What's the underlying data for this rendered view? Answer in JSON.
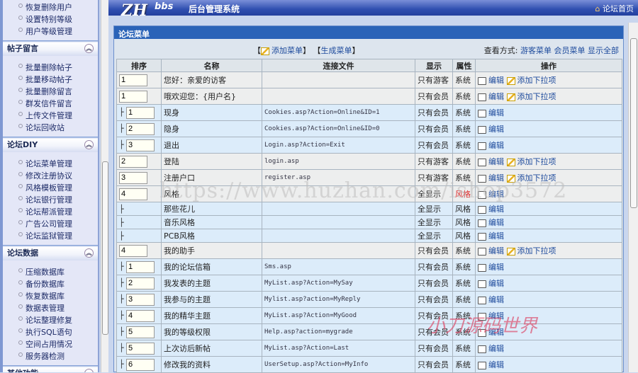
{
  "sidebar": {
    "top_items": [
      "恢复删除用户",
      "设置特别等级",
      "用户等级管理"
    ],
    "sections": [
      {
        "title": "帖子留言",
        "items": [
          "批量删除帖子",
          "批量移动帖子",
          "批量删除留言",
          "群发信件留言",
          "上传文件管理",
          "论坛回收站"
        ]
      },
      {
        "title": "论坛DIY",
        "items": [
          "论坛菜单管理",
          "修改注册协议",
          "风格模板管理",
          "论坛银行管理",
          "论坛帮派管理",
          "广告公司管理",
          "论坛监狱管理"
        ]
      },
      {
        "title": "论坛数据",
        "items": [
          "压缩数据库",
          "备份数据库",
          "恢复数据库",
          "数据表管理",
          "论坛整理修复",
          "执行SQL语句",
          "空间占用情况",
          "服务器检测"
        ]
      },
      {
        "title": "其他功能",
        "items": []
      }
    ]
  },
  "header": {
    "logo": "ZH",
    "logo_sub": "bbs",
    "system": "后台管理系统",
    "home": "论坛首页"
  },
  "panel": {
    "title": "论坛菜单",
    "add_menu": "添加菜单",
    "gen_menu": "生成菜单",
    "view_label": "查看方式:",
    "view_guest": "游客菜单",
    "view_member": "会员菜单",
    "view_all": "显示全部"
  },
  "table": {
    "headers": [
      "排序",
      "名称",
      "连接文件",
      "显示",
      "属性",
      "操作"
    ],
    "edit": "编辑",
    "add_sub": "添加下拉项",
    "rows": [
      {
        "level": "top",
        "order": "1",
        "name": "您好：亲爱的访客",
        "link": "",
        "show": "只有游客",
        "attr": "系统",
        "add": true
      },
      {
        "level": "top",
        "order": "1",
        "name": "哦欢迎您：{用户名}",
        "link": "",
        "show": "只有会员",
        "attr": "系统",
        "add": true
      },
      {
        "level": "child",
        "order": "1",
        "name": "现身",
        "link": "Cookies.asp?Action=Online&ID=1",
        "show": "只有会员",
        "attr": "系统"
      },
      {
        "level": "child",
        "order": "2",
        "name": "隐身",
        "link": "Cookies.asp?Action=Online&ID=0",
        "show": "只有会员",
        "attr": "系统"
      },
      {
        "level": "child",
        "order": "3",
        "name": "退出",
        "link": "Login.asp?Action=Exit",
        "show": "只有会员",
        "attr": "系统"
      },
      {
        "level": "top",
        "order": "2",
        "name": "登陆",
        "link": "login.asp",
        "show": "只有游客",
        "attr": "系统",
        "add": true
      },
      {
        "level": "top",
        "order": "3",
        "name": "注册户口",
        "link": "register.asp",
        "show": "只有游客",
        "attr": "系统",
        "add": true
      },
      {
        "level": "top",
        "order": "4",
        "name": "风格",
        "link": "",
        "show": "全显示",
        "attr": "风格",
        "attr_red": true
      },
      {
        "level": "child",
        "order": null,
        "name": "那些花儿",
        "link": "",
        "show": "全显示",
        "attr": "风格"
      },
      {
        "level": "child",
        "order": null,
        "name": "音乐风格",
        "link": "",
        "show": "全显示",
        "attr": "风格"
      },
      {
        "level": "child",
        "order": null,
        "name": "PCB风格",
        "link": "",
        "show": "全显示",
        "attr": "风格"
      },
      {
        "level": "top",
        "order": "4",
        "name": "我的助手",
        "link": "",
        "show": "只有会员",
        "attr": "系统",
        "add": true
      },
      {
        "level": "child",
        "order": "1",
        "name": "我的论坛信箱",
        "link": "Sms.asp",
        "show": "只有会员",
        "attr": "系统"
      },
      {
        "level": "child",
        "order": "2",
        "name": "我发表的主题",
        "link": "MyList.asp?Action=MySay",
        "show": "只有会员",
        "attr": "系统"
      },
      {
        "level": "child",
        "order": "3",
        "name": "我参与的主题",
        "link": "Mylist.asp?action=MyReply",
        "show": "只有会员",
        "attr": "系统"
      },
      {
        "level": "child",
        "order": "4",
        "name": "我的精华主题",
        "link": "MyList.asp?Action=MyGood",
        "show": "只有会员",
        "attr": "系统"
      },
      {
        "level": "child",
        "order": "5",
        "name": "我的等级权限",
        "link": "Help.asp?action=mygrade",
        "show": "只有会员",
        "attr": "系统"
      },
      {
        "level": "child",
        "order": "5",
        "name": "上次访后新帖",
        "link": "MyList.asp?Action=Last",
        "show": "只有会员",
        "attr": "系统"
      },
      {
        "level": "child",
        "order": "6",
        "name": "修改我的资料",
        "link": "UserSetup.asp?Action=MyInfo",
        "show": "只有会员",
        "attr": "系统"
      }
    ]
  },
  "watermarks": {
    "url": "https://www.huzhan.com/ishop3572",
    "brand": "小刀源码世界"
  }
}
